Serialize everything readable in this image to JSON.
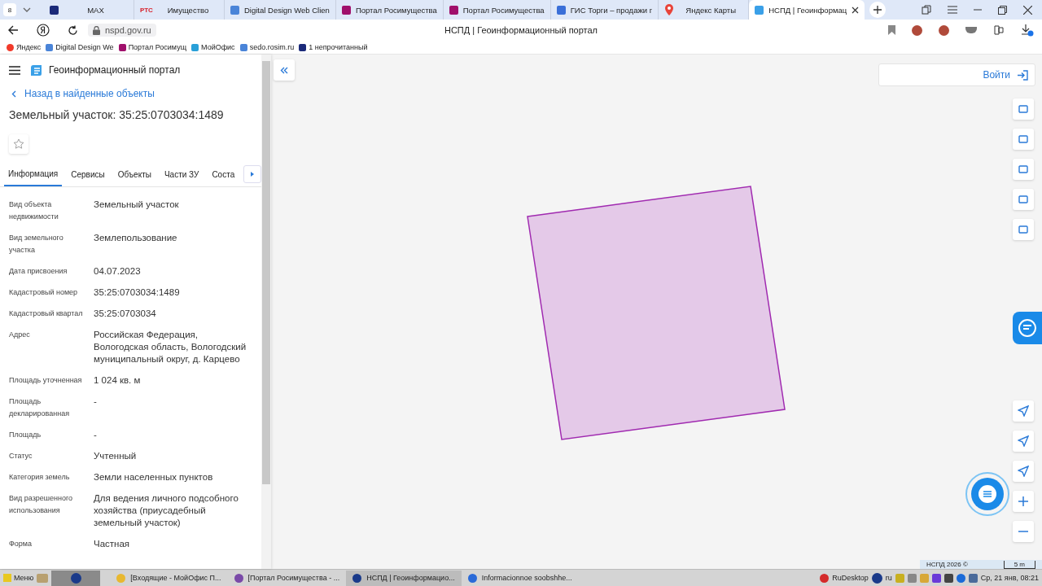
{
  "browser": {
    "tab_count": "8",
    "tabs": [
      {
        "title": "MAX",
        "selected": false
      },
      {
        "title": "Имущество",
        "icon_text": "РТС",
        "selected": false
      },
      {
        "title": "Digital Design Web Clien",
        "selected": false
      },
      {
        "title": "Портал Росимущества",
        "selected": false
      },
      {
        "title": "Портал Росимущества",
        "selected": false
      },
      {
        "title": "ГИС Торги – продажи г",
        "selected": false
      },
      {
        "title": "Яндекс Карты",
        "selected": false
      },
      {
        "title": "НСПД | Геоинформац",
        "selected": true
      }
    ],
    "url": "nspd.gov.ru",
    "page_title": "НСПД | Геоинформационный портал",
    "bookmarks": [
      {
        "label": "Яндекс"
      },
      {
        "label": "Digital Design We"
      },
      {
        "label": "Портал Росимущ"
      },
      {
        "label": "МойОфис"
      },
      {
        "label": "sedo.rosim.ru"
      },
      {
        "label": "1 непрочитанный"
      }
    ]
  },
  "app": {
    "title": "Геоинформационный портал",
    "back_link": "Назад в найденные объекты",
    "object_title": "Земельный участок: 35:25:0703034:1489",
    "tabs": [
      {
        "label": "Информация",
        "selected": true
      },
      {
        "label": "Сервисы",
        "selected": false
      },
      {
        "label": "Объекты",
        "selected": false
      },
      {
        "label": "Части ЗУ",
        "selected": false
      },
      {
        "label": "Соста",
        "selected": false
      }
    ],
    "fields": [
      {
        "label": "Вид объекта недвижимости",
        "value": "Земельный участок"
      },
      {
        "label": "Вид земельного участка",
        "value": "Землепользование"
      },
      {
        "label": "Дата присвоения",
        "value": "04.07.2023"
      },
      {
        "label": "Кадастровый номер",
        "value": "35:25:0703034:1489"
      },
      {
        "label": "Кадастровый квартал",
        "value": "35:25:0703034"
      },
      {
        "label": "Адрес",
        "value": "Российская Федерация, Вологодская область, Вологодский муниципальный округ, д. Карцево"
      },
      {
        "label": "Площадь уточненная",
        "value": "1 024 кв. м"
      },
      {
        "label": "Площадь декларированная",
        "value": "-"
      },
      {
        "label": "Площадь",
        "value": "-"
      },
      {
        "label": "Статус",
        "value": "Учтенный"
      },
      {
        "label": "Категория земель",
        "value": "Земли населенных пунктов"
      },
      {
        "label": "Вид разрешенного использования",
        "value": "Для ведения личного подсобного хозяйства (приусадебный земельный участок)"
      },
      {
        "label": "Форма",
        "value": "Частная"
      }
    ]
  },
  "map": {
    "login": "Войти",
    "copyright": "НСПД 2026 ©",
    "scale": "5 m"
  },
  "taskbar": {
    "menu": "Меню",
    "windows": [
      {
        "title": "[Входящие - МойОфис П...",
        "selected": false
      },
      {
        "title": "[Портал Росимущества - ...",
        "selected": false
      },
      {
        "title": "НСПД | Геоинформацио...",
        "selected": true
      },
      {
        "title": "Informacionnoe soobshhe...",
        "selected": false
      }
    ],
    "tray_app": "RuDesktop",
    "lang": "ru",
    "clock": "Ср, 21 янв, 08:21"
  }
}
